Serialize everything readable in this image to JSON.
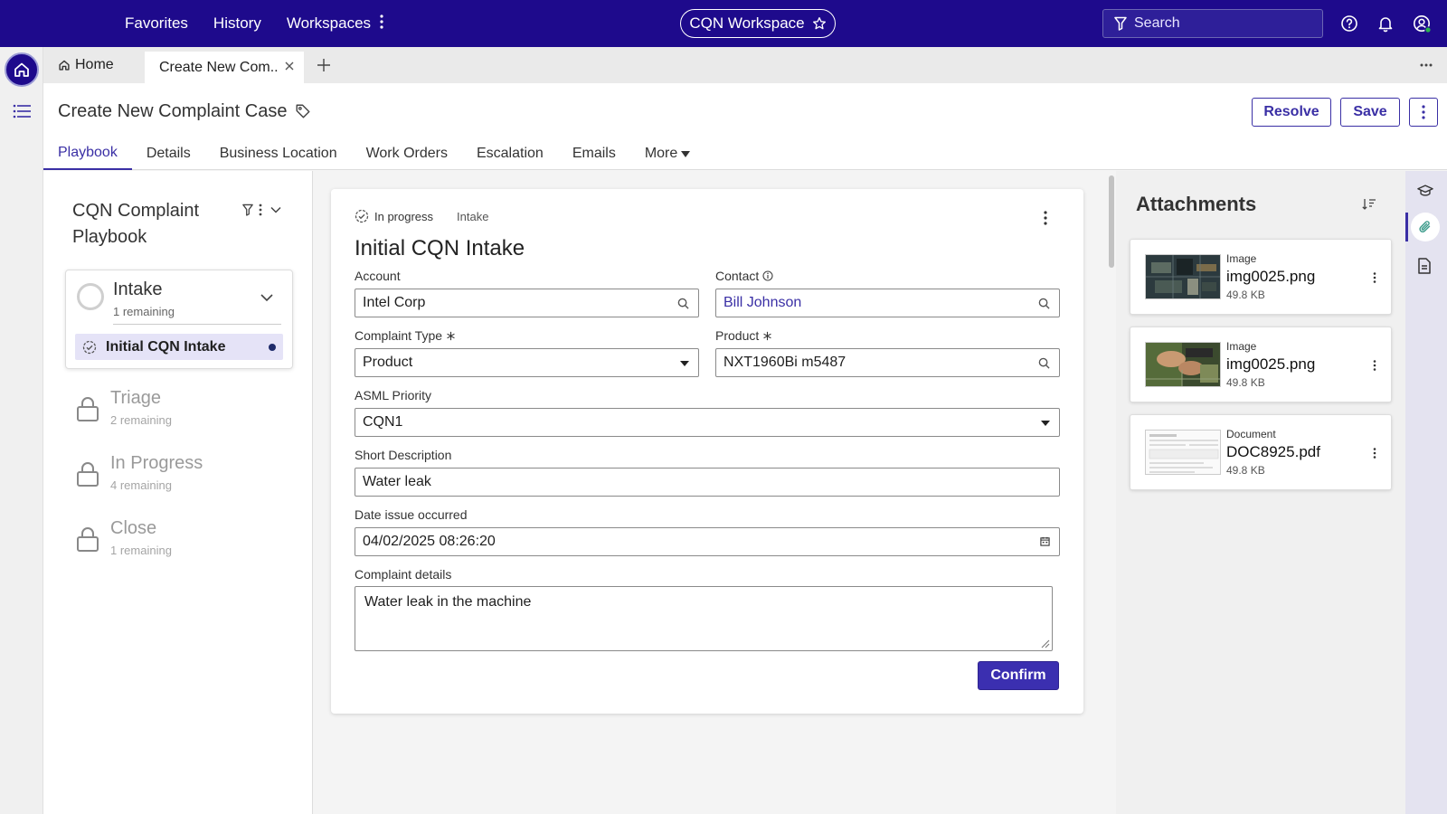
{
  "topbar": {
    "nav": [
      "Favorites",
      "History",
      "Workspaces"
    ],
    "workspace": "CQN Workspace",
    "search_placeholder": "Search"
  },
  "tabs": {
    "home": "Home",
    "active": "Create New Com.."
  },
  "header": {
    "title": "Create New Complaint Case",
    "resolve": "Resolve",
    "save": "Save",
    "subtabs": [
      "Playbook",
      "Details",
      "Business Location",
      "Work Orders",
      "Escalation",
      "Emails",
      "More"
    ]
  },
  "playbook": {
    "title": "CQN Complaint Playbook",
    "current_stage": {
      "name": "Intake",
      "count": "1 remaining"
    },
    "current_step": "Initial CQN Intake",
    "locked_stages": [
      {
        "name": "Triage",
        "count": "2 remaining"
      },
      {
        "name": "In Progress",
        "count": "4 remaining"
      },
      {
        "name": "Close",
        "count": "1 remaining"
      }
    ]
  },
  "form": {
    "status": "In progress",
    "stage": "Intake",
    "title": "Initial CQN Intake",
    "account_label": "Account",
    "account_value": "Intel Corp",
    "contact_label": "Contact",
    "contact_value": "Bill Johnson",
    "complaint_type_label": "Complaint Type",
    "complaint_type_value": "Product",
    "product_label": "Product",
    "product_value": "NXT1960Bi m5487",
    "priority_label": "ASML Priority",
    "priority_value": "CQN1",
    "short_desc_label": "Short Description",
    "short_desc_value": "Water leak",
    "date_label": "Date issue occurred",
    "date_value": "04/02/2025 08:26:20",
    "details_label": "Complaint details",
    "details_value": "Water leak in the machine",
    "confirm": "Confirm"
  },
  "attachments": {
    "title": "Attachments",
    "items": [
      {
        "kind": "Image",
        "name": "img0025.png",
        "size": "49.8 KB"
      },
      {
        "kind": "Image",
        "name": "img0025.png",
        "size": "49.8 KB"
      },
      {
        "kind": "Document",
        "name": "DOC8925.pdf",
        "size": "49.8 KB"
      }
    ]
  },
  "colors": {
    "topbar": "#1e0a8c",
    "accent": "#3a2fa5",
    "confirm": "#3b2fb0"
  },
  "icons": [
    "kebab-icon",
    "star-icon",
    "filter-icon",
    "help-icon",
    "bell-icon",
    "user-icon",
    "home-icon",
    "menu-icon",
    "close-icon",
    "plus-icon",
    "ellipsis-icon",
    "tag-icon",
    "chevron-down-icon",
    "step-check-icon",
    "lock-icon",
    "search-icon",
    "calendar-icon",
    "sort-icon",
    "graduation-cap-icon",
    "paperclip-icon",
    "document-icon"
  ]
}
